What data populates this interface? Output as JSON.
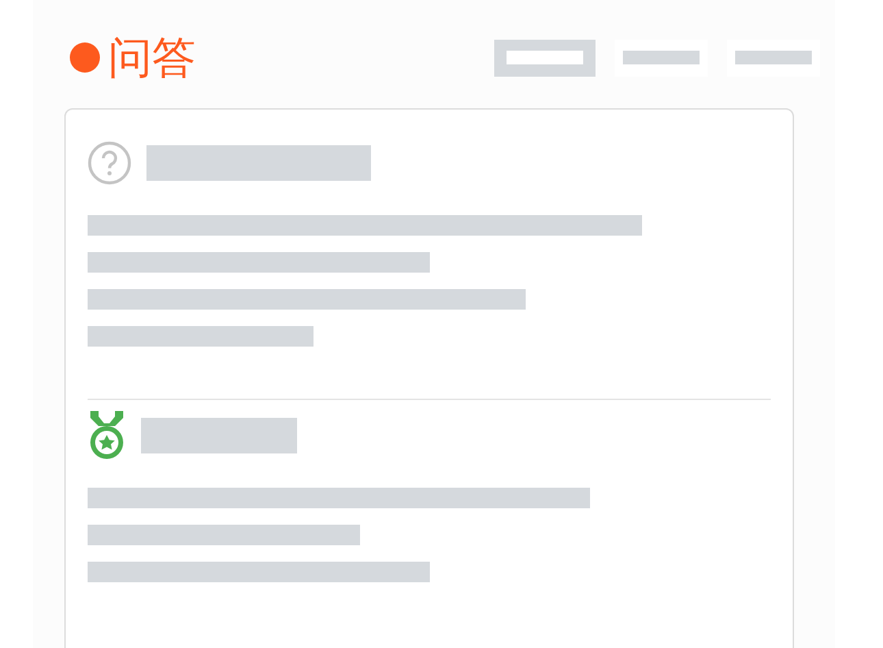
{
  "header": {
    "title": "问答"
  },
  "tabs": [
    {
      "selected": true
    },
    {
      "selected": false
    },
    {
      "selected": false
    }
  ],
  "sections": [
    {
      "kind": "question"
    },
    {
      "kind": "answer"
    }
  ]
}
